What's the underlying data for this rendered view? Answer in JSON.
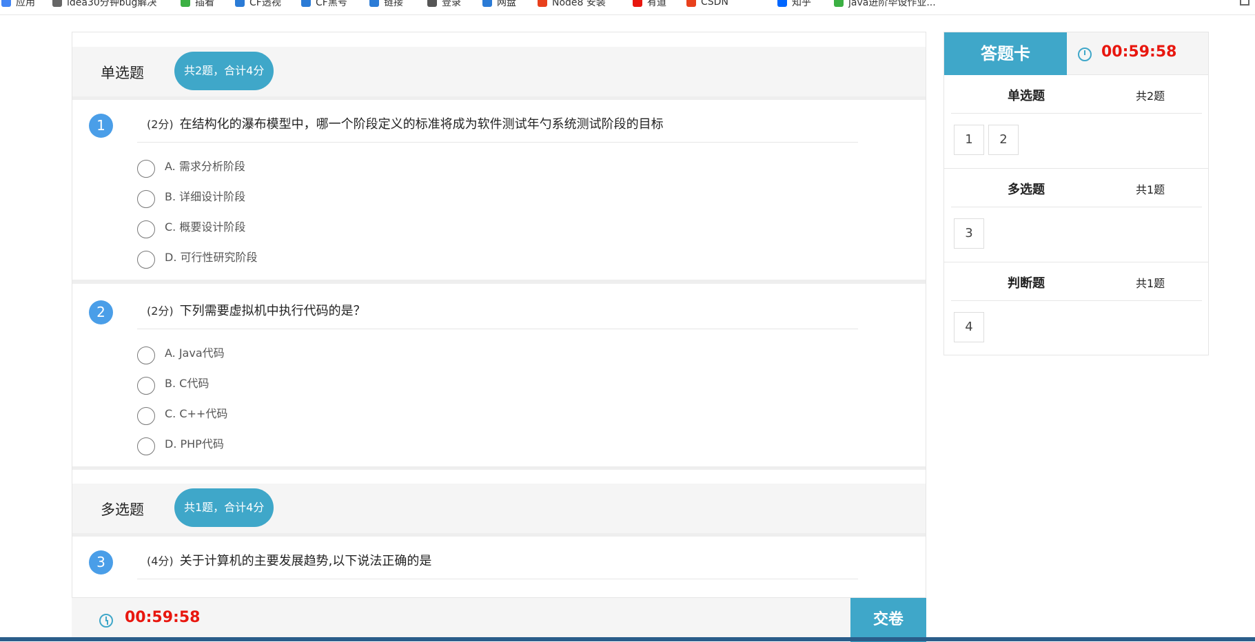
{
  "bookmarks": [
    {
      "label": "应用",
      "color": "#4285f4"
    },
    {
      "label": "idea30分钟bug解决",
      "color": "#666666"
    },
    {
      "label": "插看",
      "color": "#3cb043"
    },
    {
      "label": "CF透视",
      "color": "#2b7bd6"
    },
    {
      "label": "CF黑号",
      "color": "#2b7bd6"
    },
    {
      "label": "链接",
      "color": "#2b7bd6"
    },
    {
      "label": "登录",
      "color": "#555555"
    },
    {
      "label": "网盘",
      "color": "#2b7bd6"
    },
    {
      "label": "Node8 安装",
      "color": "#e8401c"
    },
    {
      "label": "有道",
      "color": "#e8170f"
    },
    {
      "label": "CSDN",
      "color": "#e8401c"
    },
    {
      "label": "知乎",
      "color": "#0066ff"
    },
    {
      "label": "java进阶毕设作业...",
      "color": "#3cb043"
    }
  ],
  "sections": [
    {
      "title": "单选题",
      "summary": "共2题，合计4分",
      "questions": [
        {
          "number": "1",
          "score": "(2分)",
          "text": "在结构化的瀑布模型中，哪一个阶段定义的标准将成为软件测试年勺系统测试阶段的目标",
          "options": [
            "A. 需求分析阶段",
            "B. 详细设计阶段",
            "C. 概要设计阶段",
            "D. 可行性研究阶段"
          ]
        },
        {
          "number": "2",
          "score": "(2分)",
          "text": "下列需要虚拟机中执行代码的是？",
          "options": [
            "A. Java代码",
            "B. C代码",
            "C. C++代码",
            "D. PHP代码"
          ]
        }
      ]
    },
    {
      "title": "多选题",
      "summary": "共1题，合计4分",
      "questions": [
        {
          "number": "3",
          "score": "(4分)",
          "text": "关于计算机的主要发展趋势,以下说法正确的是",
          "options": []
        }
      ]
    }
  ],
  "bottom_bar": {
    "timer": "00:59:58",
    "submit_label": "交卷"
  },
  "answer_card": {
    "title": "答题卡",
    "timer": "00:59:58",
    "sections": [
      {
        "name": "单选题",
        "count": "共2题",
        "numbers": [
          "1",
          "2"
        ]
      },
      {
        "name": "多选题",
        "count": "共1题",
        "numbers": [
          "3"
        ]
      },
      {
        "name": "判断题",
        "count": "共1题",
        "numbers": [
          "4"
        ]
      }
    ]
  },
  "colors": {
    "accent": "#3fa7c9",
    "number_badge": "#4a9ee8",
    "timer": "#e8170f"
  }
}
